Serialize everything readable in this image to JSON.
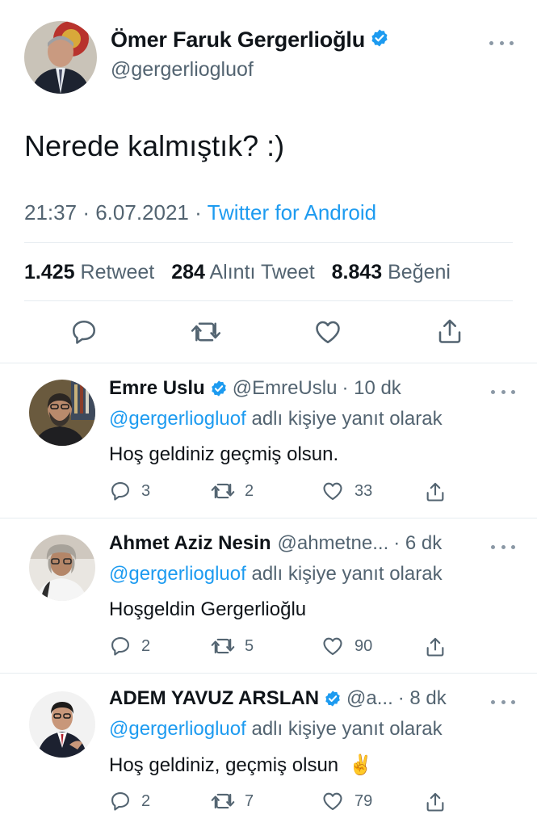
{
  "main_tweet": {
    "display_name": "Ömer Faruk Gergerlioğlu",
    "handle": "@gergerliogluof",
    "text": "Nerede kalmıştık? :)",
    "time": "21:37",
    "date": "6.07.2021",
    "separator": "·",
    "source": "Twitter for Android",
    "retweets": "1.425",
    "retweets_label": "Retweet",
    "quotes": "284",
    "quotes_label": "Alıntı Tweet",
    "likes": "8.843",
    "likes_label": "Beğeni"
  },
  "replies": [
    {
      "display_name": "Emre Uslu",
      "verified": true,
      "handle": "@EmreUslu",
      "time": "· 10 dk",
      "reply_mention": "@gergerliogluof",
      "reply_suffix": "adlı kişiye yanıt olarak",
      "text": "Hoş geldiniz geçmiş olsun.",
      "replies": "3",
      "retweets": "2",
      "likes": "33"
    },
    {
      "display_name": "Ahmet Aziz Nesin",
      "verified": false,
      "handle": "@ahmetne...",
      "time": "· 6 dk",
      "reply_mention": "@gergerliogluof",
      "reply_suffix": "adlı kişiye yanıt olarak",
      "text": "Hoşgeldin Gergerlioğlu",
      "replies": "2",
      "retweets": "5",
      "likes": "90"
    },
    {
      "display_name": "ADEM YAVUZ ARSLAN",
      "verified": true,
      "handle": "@a...",
      "time": "· 8 dk",
      "reply_mention": "@gergerliogluof",
      "reply_suffix": "adlı kişiye yanıt olarak",
      "text": "Hoş geldiniz, geçmiş olsun",
      "emoji": "✌️",
      "replies": "2",
      "retweets": "7",
      "likes": "79"
    }
  ],
  "colors": {
    "accent": "#1d9bf0",
    "secondary_text": "#536471",
    "divider": "#e6ecf0",
    "icon": "#536471"
  },
  "icons": [
    "reply-icon",
    "retweet-icon",
    "like-icon",
    "share-icon",
    "more-icon",
    "verified-badge-icon"
  ]
}
